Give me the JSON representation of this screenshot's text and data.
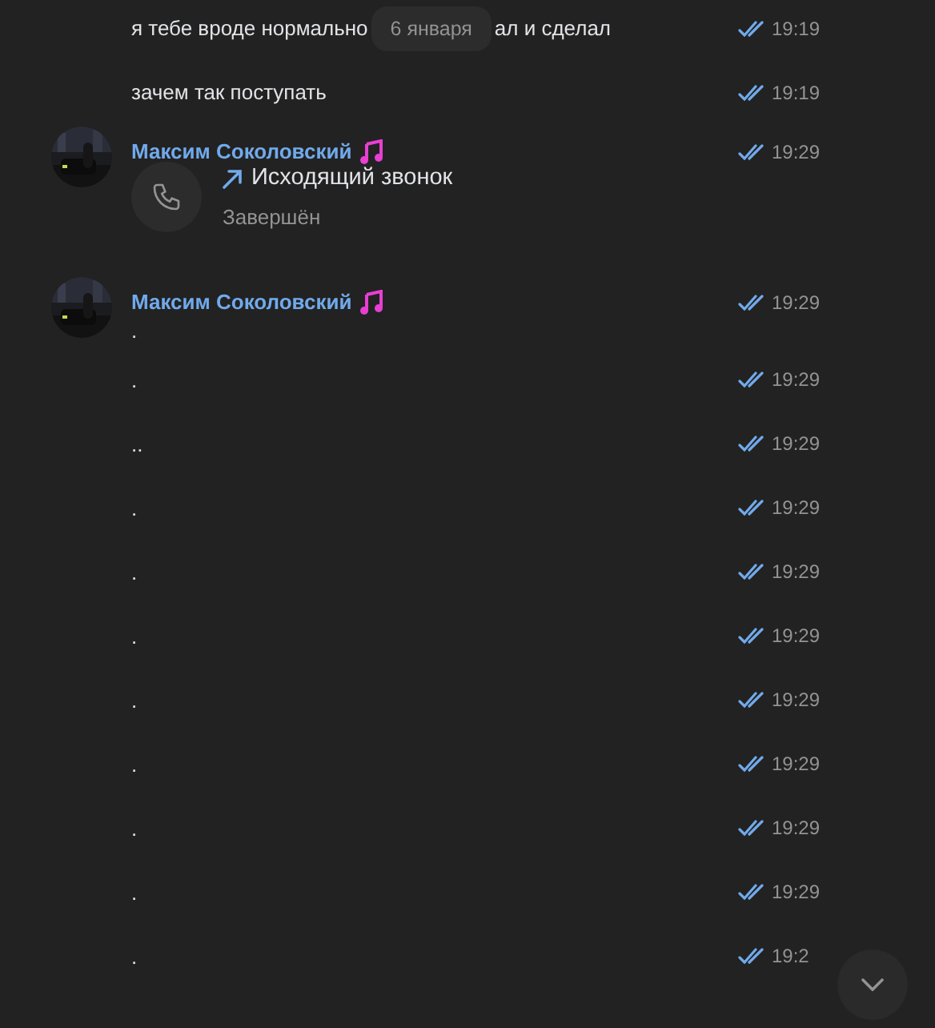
{
  "date_badge": "6 января",
  "groups": [
    {
      "kind": "continuation",
      "messages": [
        {
          "text_parts": [
            "я тебе вроде нормально",
            "ал и сделал"
          ],
          "time": "19:19",
          "read": true
        },
        {
          "text_parts": [
            "зачем так поступать"
          ],
          "time": "19:19",
          "read": true
        }
      ]
    },
    {
      "kind": "author",
      "name": "Максим Соколовский",
      "time": "19:29",
      "read": true,
      "call": {
        "title": "Исходящий звонок",
        "status": "Завершён"
      }
    },
    {
      "kind": "author",
      "name": "Максим Соколовский",
      "time": "19:29",
      "read": true,
      "messages": [
        {
          "text_parts": [
            "."
          ]
        },
        {
          "text_parts": [
            "."
          ],
          "time": "19:29",
          "read": true
        },
        {
          "text_parts": [
            ".."
          ],
          "time": "19:29",
          "read": true
        },
        {
          "text_parts": [
            "."
          ],
          "time": "19:29",
          "read": true
        },
        {
          "text_parts": [
            "."
          ],
          "time": "19:29",
          "read": true
        },
        {
          "text_parts": [
            "."
          ],
          "time": "19:29",
          "read": true
        },
        {
          "text_parts": [
            "."
          ],
          "time": "19:29",
          "read": true
        },
        {
          "text_parts": [
            "."
          ],
          "time": "19:29",
          "read": true
        },
        {
          "text_parts": [
            "."
          ],
          "time": "19:29",
          "read": true
        },
        {
          "text_parts": [
            "."
          ],
          "time": "19:29",
          "read": true
        },
        {
          "text_parts": [
            "."
          ],
          "time": "19:2",
          "read": true
        }
      ]
    }
  ]
}
